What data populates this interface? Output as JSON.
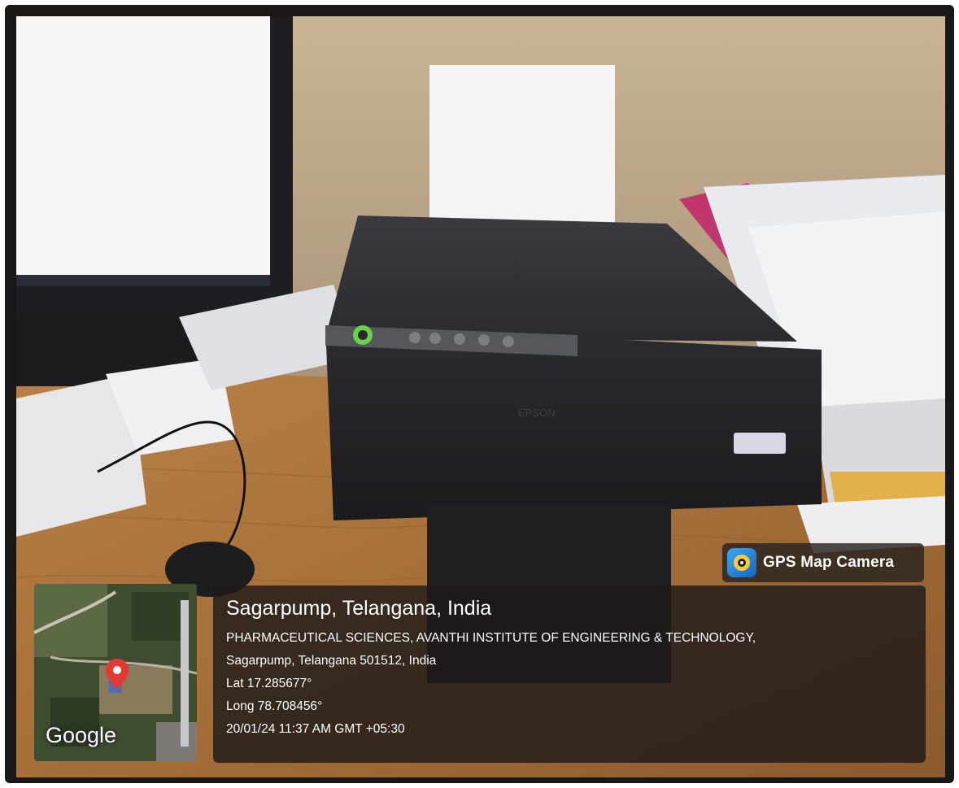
{
  "overlay": {
    "brand": {
      "icon": "camera-pin-icon",
      "label": "GPS Map Camera"
    },
    "location": {
      "title": "Sagarpump, Telangana, India",
      "address_line1": "PHARMACEUTICAL SCIENCES, AVANTHI INSTITUTE OF ENGINEERING & TECHNOLOGY,",
      "address_line2": "Sagarpump, Telangana 501512, India",
      "latitude": "Lat 17.285677°",
      "longitude": "Long 78.708456°",
      "timestamp": "20/01/24 11:37 AM GMT +05:30"
    },
    "map": {
      "provider_label": "Google",
      "marker_icon": "map-pin-icon",
      "marker_color": "#e53935"
    }
  },
  "photo": {
    "device_brand": "EPSON",
    "colors": {
      "frame": "#1a1717",
      "wall": "#b8a486",
      "desk": "#b0783f",
      "printer": "#26262a",
      "power_button": "#6ad14a"
    }
  }
}
